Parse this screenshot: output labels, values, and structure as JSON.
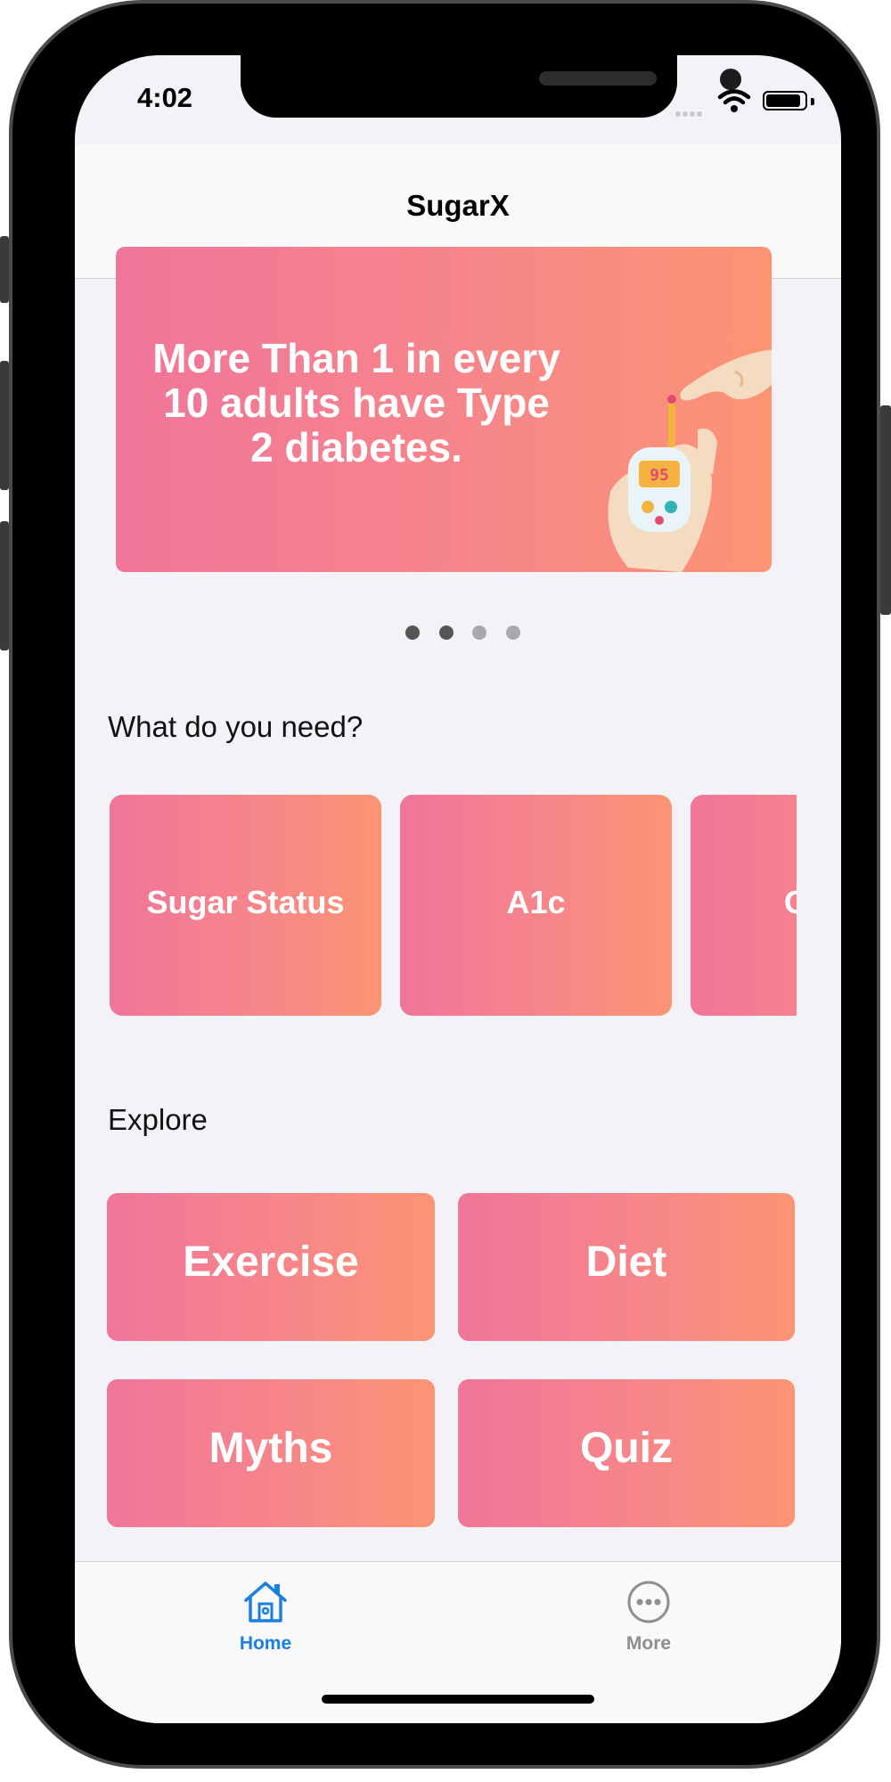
{
  "status_bar": {
    "time": "4:02"
  },
  "nav": {
    "title": "SugarX"
  },
  "banner": {
    "line1": "More Than 1  in every",
    "line2": "10 adults have Type",
    "line3": "2 diabetes.",
    "meter_reading": "95",
    "page_count": 4,
    "active_page": 2
  },
  "need_section": {
    "title": "What do you need?",
    "cards": [
      {
        "label": "Sugar Status"
      },
      {
        "label": "A1c"
      },
      {
        "label": "G"
      }
    ]
  },
  "explore_section": {
    "title": "Explore",
    "cards": [
      {
        "label": "Exercise"
      },
      {
        "label": "Diet"
      },
      {
        "label": "Myths"
      },
      {
        "label": "Quiz"
      }
    ]
  },
  "tab_bar": {
    "home": {
      "label": "Home",
      "icon": "house-icon",
      "active": true
    },
    "more": {
      "label": "More",
      "icon": "ellipsis-circle-icon",
      "active": false
    }
  },
  "colors": {
    "gradient_start": "#f0759a",
    "gradient_end": "#fc9473",
    "tab_active": "#1a7fe0",
    "tab_inactive": "#8e8e93",
    "background": "#f2f2f7"
  }
}
